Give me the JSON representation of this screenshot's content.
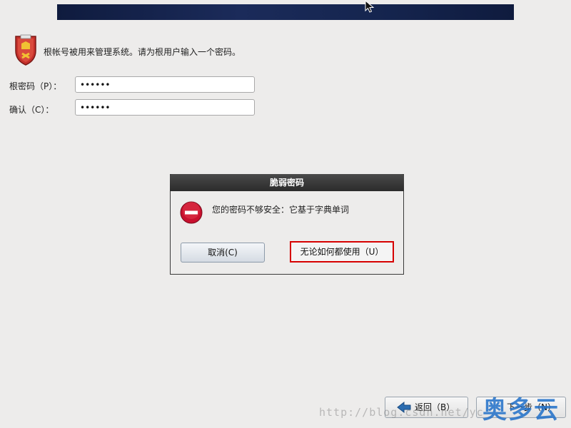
{
  "intro": {
    "text": "根帐号被用来管理系统。请为根用户输入一个密码。"
  },
  "form": {
    "root_password_label": "根密码（P）：",
    "root_password_value": "••••••",
    "confirm_label": "确认（C）：",
    "confirm_value": "••••••"
  },
  "dialog": {
    "title": "脆弱密码",
    "message": "您的密码不够安全：它基于字典单词",
    "cancel_label": "取消(C)",
    "use_anyway_label": "无论如何都使用（U）"
  },
  "nav": {
    "back_label": "返回（B）",
    "next_label": "下一步（N）"
  },
  "watermark": {
    "url": "http://blog.csdn.net/yc",
    "logo": "奥多云"
  }
}
